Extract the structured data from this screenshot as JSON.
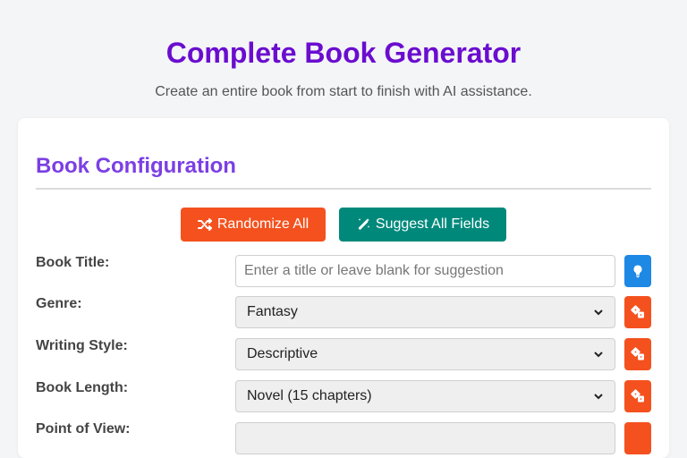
{
  "header": {
    "title": "Complete Book Generator",
    "subtitle": "Create an entire book from start to finish with AI assistance."
  },
  "config": {
    "section_title": "Book Configuration",
    "randomize_label": "Randomize All",
    "suggest_label": "Suggest All Fields",
    "fields": [
      {
        "label": "Book Title:",
        "placeholder": "Enter a title or leave blank for suggestion",
        "value": "",
        "action_icon": "lightbulb-icon"
      },
      {
        "label": "Genre:",
        "value": "Fantasy",
        "action_icon": "dice-icon"
      },
      {
        "label": "Writing Style:",
        "value": "Descriptive",
        "action_icon": "dice-icon"
      },
      {
        "label": "Book Length:",
        "value": "Novel (15 chapters)",
        "action_icon": "dice-icon"
      },
      {
        "label": "Point of View:",
        "value": "",
        "action_icon": "dice-icon"
      }
    ]
  },
  "colors": {
    "title": "#6a0dcf",
    "section_title": "#7b3fe4",
    "randomize": "#f4511e",
    "suggest": "#00897b",
    "suggest_icon": "#1e88e5"
  }
}
